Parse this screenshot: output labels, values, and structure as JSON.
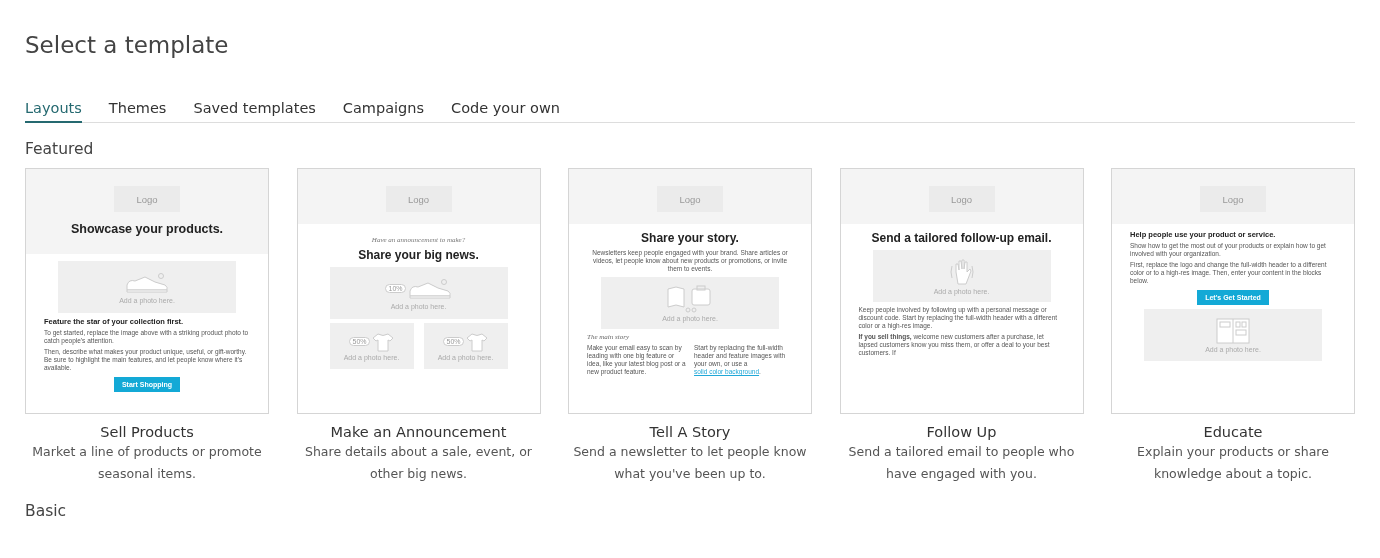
{
  "page_title": "Select a template",
  "tabs": [
    {
      "label": "Layouts",
      "selected": true
    },
    {
      "label": "Themes",
      "selected": false
    },
    {
      "label": "Saved templates",
      "selected": false
    },
    {
      "label": "Campaigns",
      "selected": false
    },
    {
      "label": "Code your own",
      "selected": false
    }
  ],
  "sections": [
    {
      "heading": "Featured",
      "templates": [
        {
          "title": "Sell Products",
          "description": "Market a line of products or promote seasonal items.",
          "preview": {
            "logo": "Logo",
            "banner_heading": "Showcase your products.",
            "blocks": [
              {
                "kind": "photo",
                "caption": "Add a photo here."
              },
              {
                "kind": "subheading",
                "text": "Feature the star of your collection first."
              },
              {
                "kind": "text",
                "text": "To get started, replace the image above with a striking product photo to catch people's attention."
              },
              {
                "kind": "text",
                "text": "Then, describe what makes your product unique, useful, or gift-worthy. Be sure to highlight the main features, and let people know where it's available."
              },
              {
                "kind": "button",
                "label": "Start Shopping"
              }
            ]
          }
        },
        {
          "title": "Make an Announcement",
          "description": "Share details about a sale, event, or other big news.",
          "preview": {
            "logo": "Logo",
            "blocks": [
              {
                "kind": "kicker",
                "text": "Have an announcement to make?"
              },
              {
                "kind": "heading",
                "text": "Share your big news."
              },
              {
                "kind": "photo",
                "tag": "10%",
                "caption": "Add a photo here."
              },
              {
                "kind": "photo_pair",
                "items": [
                  {
                    "tag": "50%",
                    "caption": "Add a photo here."
                  },
                  {
                    "tag": "50%",
                    "caption": "Add a photo here."
                  }
                ]
              }
            ]
          }
        },
        {
          "title": "Tell A Story",
          "description": "Send a newsletter to let people know what you've been up to.",
          "preview": {
            "logo": "Logo",
            "blocks": [
              {
                "kind": "heading",
                "text": "Share your story."
              },
              {
                "kind": "lead",
                "text": "Newsletters keep people engaged with your brand. Share articles or videos, let people know about new products or promotions, or invite them to events."
              },
              {
                "kind": "photo",
                "caption": "Add a photo here."
              },
              {
                "kind": "serif_title",
                "text": "The main story"
              },
              {
                "kind": "columns",
                "items": [
                  {
                    "text": "Make your email easy to scan by leading with one big feature or idea, like your latest blog post or a new product feature."
                  },
                  {
                    "text": "Start by replacing the full-width header and feature images with your own, or use a ",
                    "link": "solid color background",
                    "end": "."
                  }
                ]
              }
            ]
          }
        },
        {
          "title": "Follow Up",
          "description": "Send a tailored email to people who have engaged with you.",
          "preview": {
            "logo": "Logo",
            "blocks": [
              {
                "kind": "heading",
                "text": "Send a tailored follow-up email."
              },
              {
                "kind": "photo",
                "caption": "Add a photo here."
              },
              {
                "kind": "text",
                "text": "Keep people involved by following up with a personal message or discount code. Start by replacing the full-width header with a different color or a high-res image."
              },
              {
                "kind": "text",
                "text": "**If you sell things,** welcome new customers after a purchase, let lapsed customers know you miss them, or offer a deal to your best customers. If"
              }
            ]
          }
        },
        {
          "title": "Educate",
          "description": "Explain your products or share knowledge about a topic.",
          "preview": {
            "logo": "Logo",
            "blocks": [
              {
                "kind": "subheading",
                "text": "Help people use your product or service."
              },
              {
                "kind": "text",
                "text": "Show how to get the most out of your products or explain how to get involved with your organization."
              },
              {
                "kind": "text",
                "text": "First, replace the logo and change the full-width header to a different color or to a high-res image. Then, enter your content in the blocks below."
              },
              {
                "kind": "button",
                "label": "Let's Get Started"
              },
              {
                "kind": "photo",
                "caption": "Add a photo here."
              }
            ]
          }
        }
      ]
    },
    {
      "heading": "Basic"
    }
  ]
}
